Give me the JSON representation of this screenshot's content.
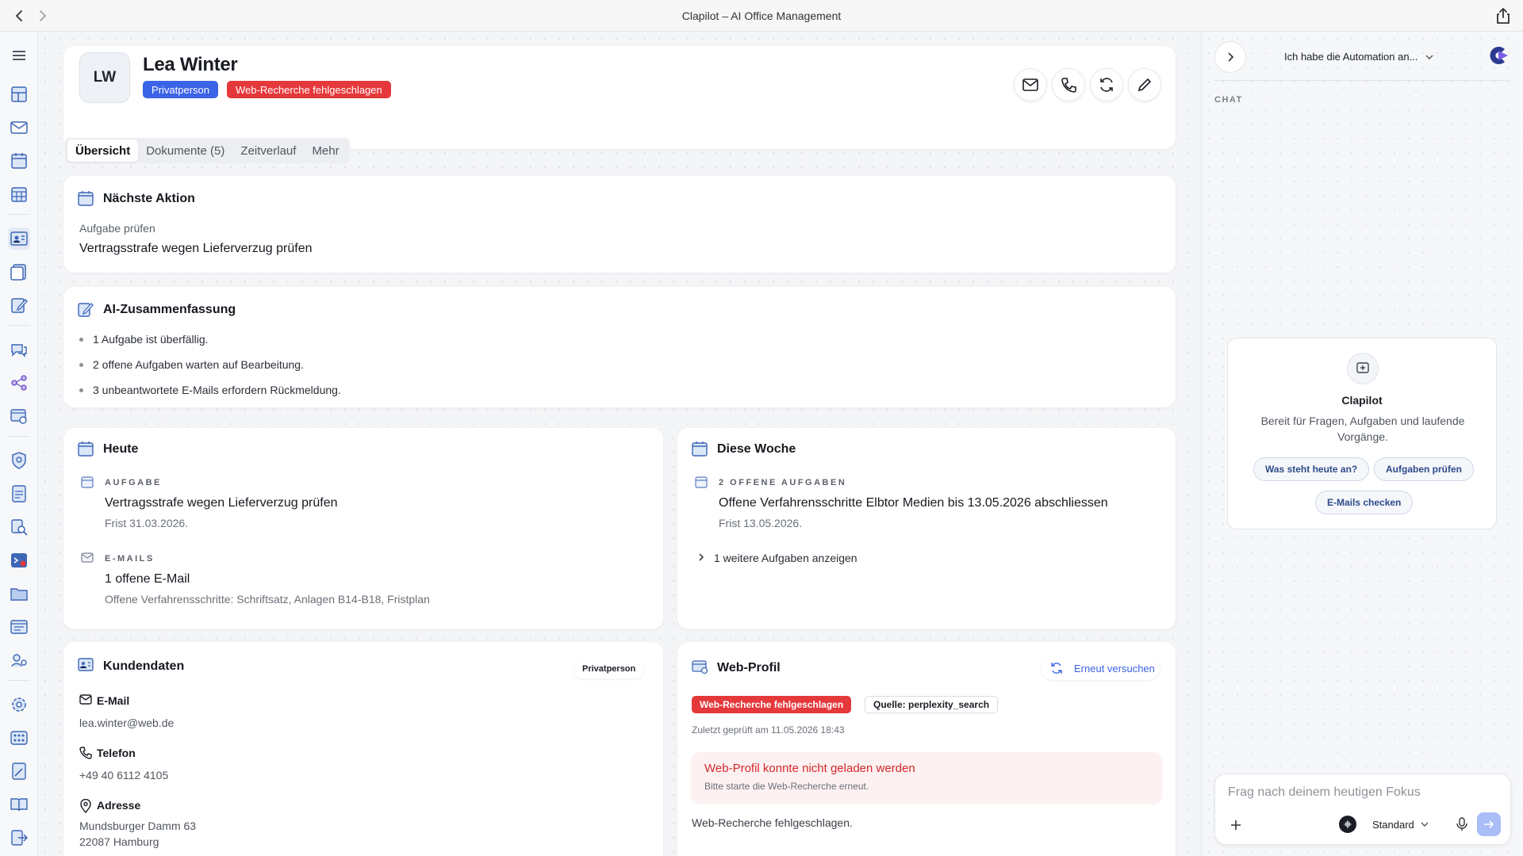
{
  "window": {
    "title": "Clapilot – AI Office Management"
  },
  "contact": {
    "initials": "LW",
    "name": "Lea Winter",
    "badges": [
      {
        "label": "Privatperson",
        "color": "#3b63e6"
      },
      {
        "label": "Web-Recherche fehlgeschlagen",
        "color": "#e5383b"
      }
    ]
  },
  "tabs": [
    "Übersicht",
    "Dokumente (5)",
    "Zeitverlauf",
    "Mehr"
  ],
  "next_action": {
    "title": "Nächste Aktion",
    "label": "Aufgabe prüfen",
    "value": "Vertragsstrafe wegen Lieferverzug prüfen"
  },
  "ai_summary": {
    "title": "AI-Zusammenfassung",
    "items": [
      "1 Aufgabe ist überfällig.",
      "2 offene Aufgaben warten auf Bearbeitung.",
      "3 unbeantwortete E-Mails erfordern Rückmeldung."
    ]
  },
  "today": {
    "title": "Heute",
    "task_caps": "AUFGABE",
    "task_title": "Vertragsstrafe wegen Lieferverzug prüfen",
    "task_due": "Frist 31.03.2026.",
    "email_caps": "E-MAILS",
    "email_title": "1 offene E-Mail",
    "email_sub": "Offene Verfahrensschritte: Schriftsatz, Anlagen B14-B18, Fristplan"
  },
  "week": {
    "title": "Diese Woche",
    "caps": "2 OFFENE AUFGABEN",
    "task_title": "Offene Verfahrensschritte Elbtor Medien bis 13.05.2026 abschliessen",
    "task_due": "Frist 13.05.2026.",
    "more": "1 weitere Aufgaben anzeigen"
  },
  "customer": {
    "title": "Kundendaten",
    "type_chip": "Privatperson",
    "email_label": "E-Mail",
    "email": "lea.winter@web.de",
    "phone_label": "Telefon",
    "phone": "+49 40 6112 4105",
    "address_label": "Adresse",
    "address_line1": "Mundsburger Damm 63",
    "address_line2": "22087 Hamburg"
  },
  "web_profile": {
    "title": "Web-Profil",
    "retry": "Erneut versuchen",
    "status_chip": "Web-Recherche fehlgeschlagen",
    "source_chip": "Quelle: perplexity_search",
    "checked": "Zuletzt geprüft am 11.05.2026 18:43",
    "error_title": "Web-Profil konnte nicht geladen werden",
    "error_sub": "Bitte starte die Web-Recherche erneut.",
    "footer": "Web-Recherche fehlgeschlagen."
  },
  "chat": {
    "selected": "Ich habe die Automation an...",
    "section": "CHAT",
    "assistant_name": "Clapilot",
    "assistant_text": "Bereit für Fragen, Aufgaben und laufende Vorgänge.",
    "suggestions": [
      "Was steht heute an?",
      "Aufgaben prüfen",
      "E-Mails checken"
    ],
    "placeholder": "Frag nach deinem heutigen Fokus",
    "mode": "Standard"
  },
  "icons": [
    "menu-icon",
    "dashboard-icon",
    "mail-icon",
    "calendar-icon",
    "calendar-grid-icon",
    "contacts-icon",
    "documents-icon",
    "edit-note-icon",
    "chat-icon",
    "workflow-icon",
    "web-settings-icon",
    "shield-icon",
    "report-icon",
    "search-doc-icon",
    "terminal-icon",
    "folder-icon",
    "browser-icon",
    "users-gear-icon",
    "settings-icon",
    "apps-icon",
    "file-edit-icon",
    "book-icon",
    "logout-icon"
  ],
  "colors": {
    "accent": "#3b63e6",
    "danger": "#e5383b",
    "error_bg": "#fdf1f1"
  }
}
